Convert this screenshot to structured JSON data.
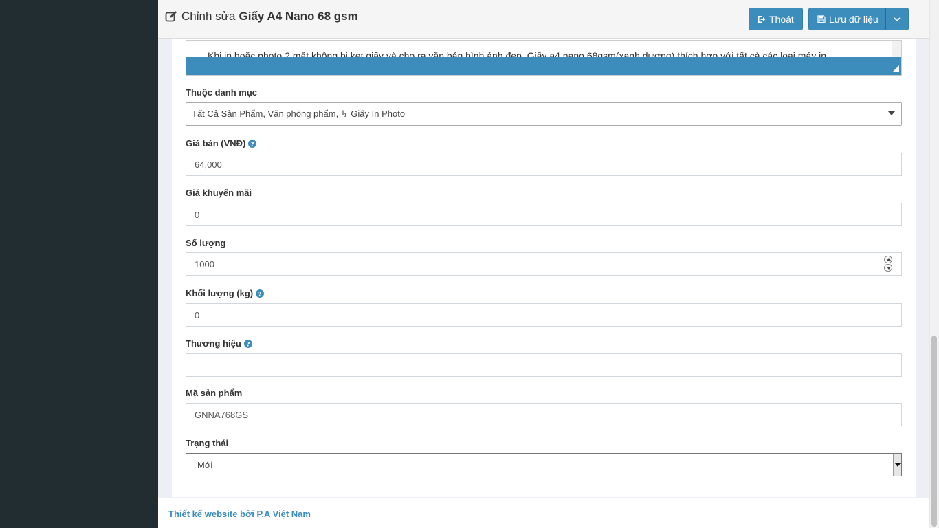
{
  "header": {
    "title_prefix": "Chỉnh sửa",
    "title_product": "Giấy A4 Nano 68 gsm",
    "exit_label": "Thoát",
    "save_label": "Lưu dữ liệu"
  },
  "editor": {
    "text": "Khi in hoặc photo 2 mặt không bị kẹt giấy và cho ra văn bản hình ảnh đẹp. Giấy a4 nano 68gsm(xanh dương) thích hợp với tất cả các loại máy in."
  },
  "form": {
    "category": {
      "label": "Thuộc danh mục",
      "value": "Tất Cả Sản Phẩm, Văn phòng phẩm, ↳ Giấy In Photo"
    },
    "price": {
      "label": "Giá bán (VNĐ)",
      "value": "64,000"
    },
    "promo_price": {
      "label": "Giá khuyến mãi",
      "value": "0"
    },
    "quantity": {
      "label": "Số lượng",
      "value": "1000"
    },
    "weight": {
      "label": "Khối lượng (kg)",
      "value": "0"
    },
    "brand": {
      "label": "Thương hiệu",
      "value": ""
    },
    "sku": {
      "label": "Mã sản phẩm",
      "value": "GNNA768GS"
    },
    "status": {
      "label": "Trạng thái",
      "value": "Mới"
    }
  },
  "footer": {
    "text": "Thiết kế website bởi P.A Việt Nam"
  },
  "colors": {
    "accent": "#3c8dbc",
    "sidebar": "#222d32",
    "background": "#ecf0f5"
  },
  "icons": {
    "title": "edit-icon",
    "exit": "sign-out-icon",
    "save": "floppy-disk-icon",
    "dropdown": "chevron-down-icon",
    "help": "question-circle-icon",
    "resize": "resize-handle-icon"
  }
}
